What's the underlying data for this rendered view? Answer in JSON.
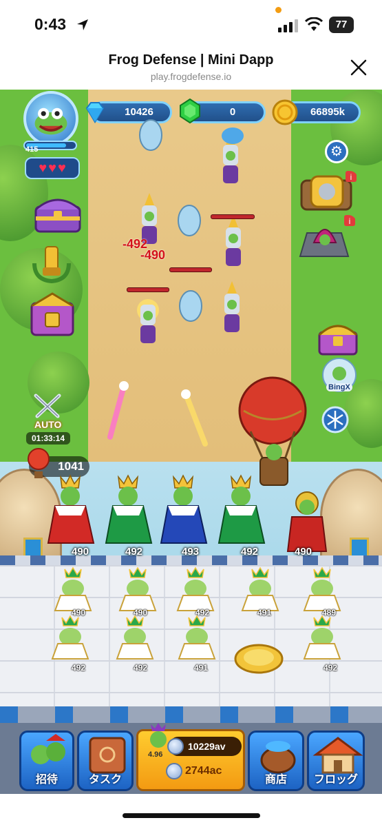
{
  "status_bar": {
    "time": "0:43",
    "battery": "77"
  },
  "browser": {
    "title": "Frog Defense | Mini Dapp",
    "url": "play.frogdefense.io"
  },
  "player": {
    "level": "415"
  },
  "resources": {
    "diamonds": "10426",
    "gems": "0",
    "gold": "66895k"
  },
  "left_panel": {
    "auto_label": "AUTO",
    "auto_timer": "01:33:14",
    "count": "1041"
  },
  "right_panel": {
    "bingx_label": "BingX"
  },
  "battle": {
    "damage_numbers": [
      "-492",
      "-490"
    ],
    "king_values": [
      "490",
      "492",
      "493",
      "492",
      "490"
    ]
  },
  "frog_grid": {
    "row1": [
      "490",
      "490",
      "492",
      "491",
      "489"
    ],
    "row2": [
      "492",
      "492",
      "491",
      "",
      "492"
    ]
  },
  "bottom_nav": {
    "invite": "招待",
    "tasks": "タスク",
    "center_level": "4.96",
    "center_value_1": "10229av",
    "center_value_2": "2744ac",
    "shop": "商店",
    "frogs": "フロッグ"
  },
  "colors": {
    "grass": "#6bbf3f",
    "path": "#e6c381",
    "nav_blue": "#2f7fe0",
    "center_gold": "#f7b522",
    "damage_red": "#d4121b"
  }
}
